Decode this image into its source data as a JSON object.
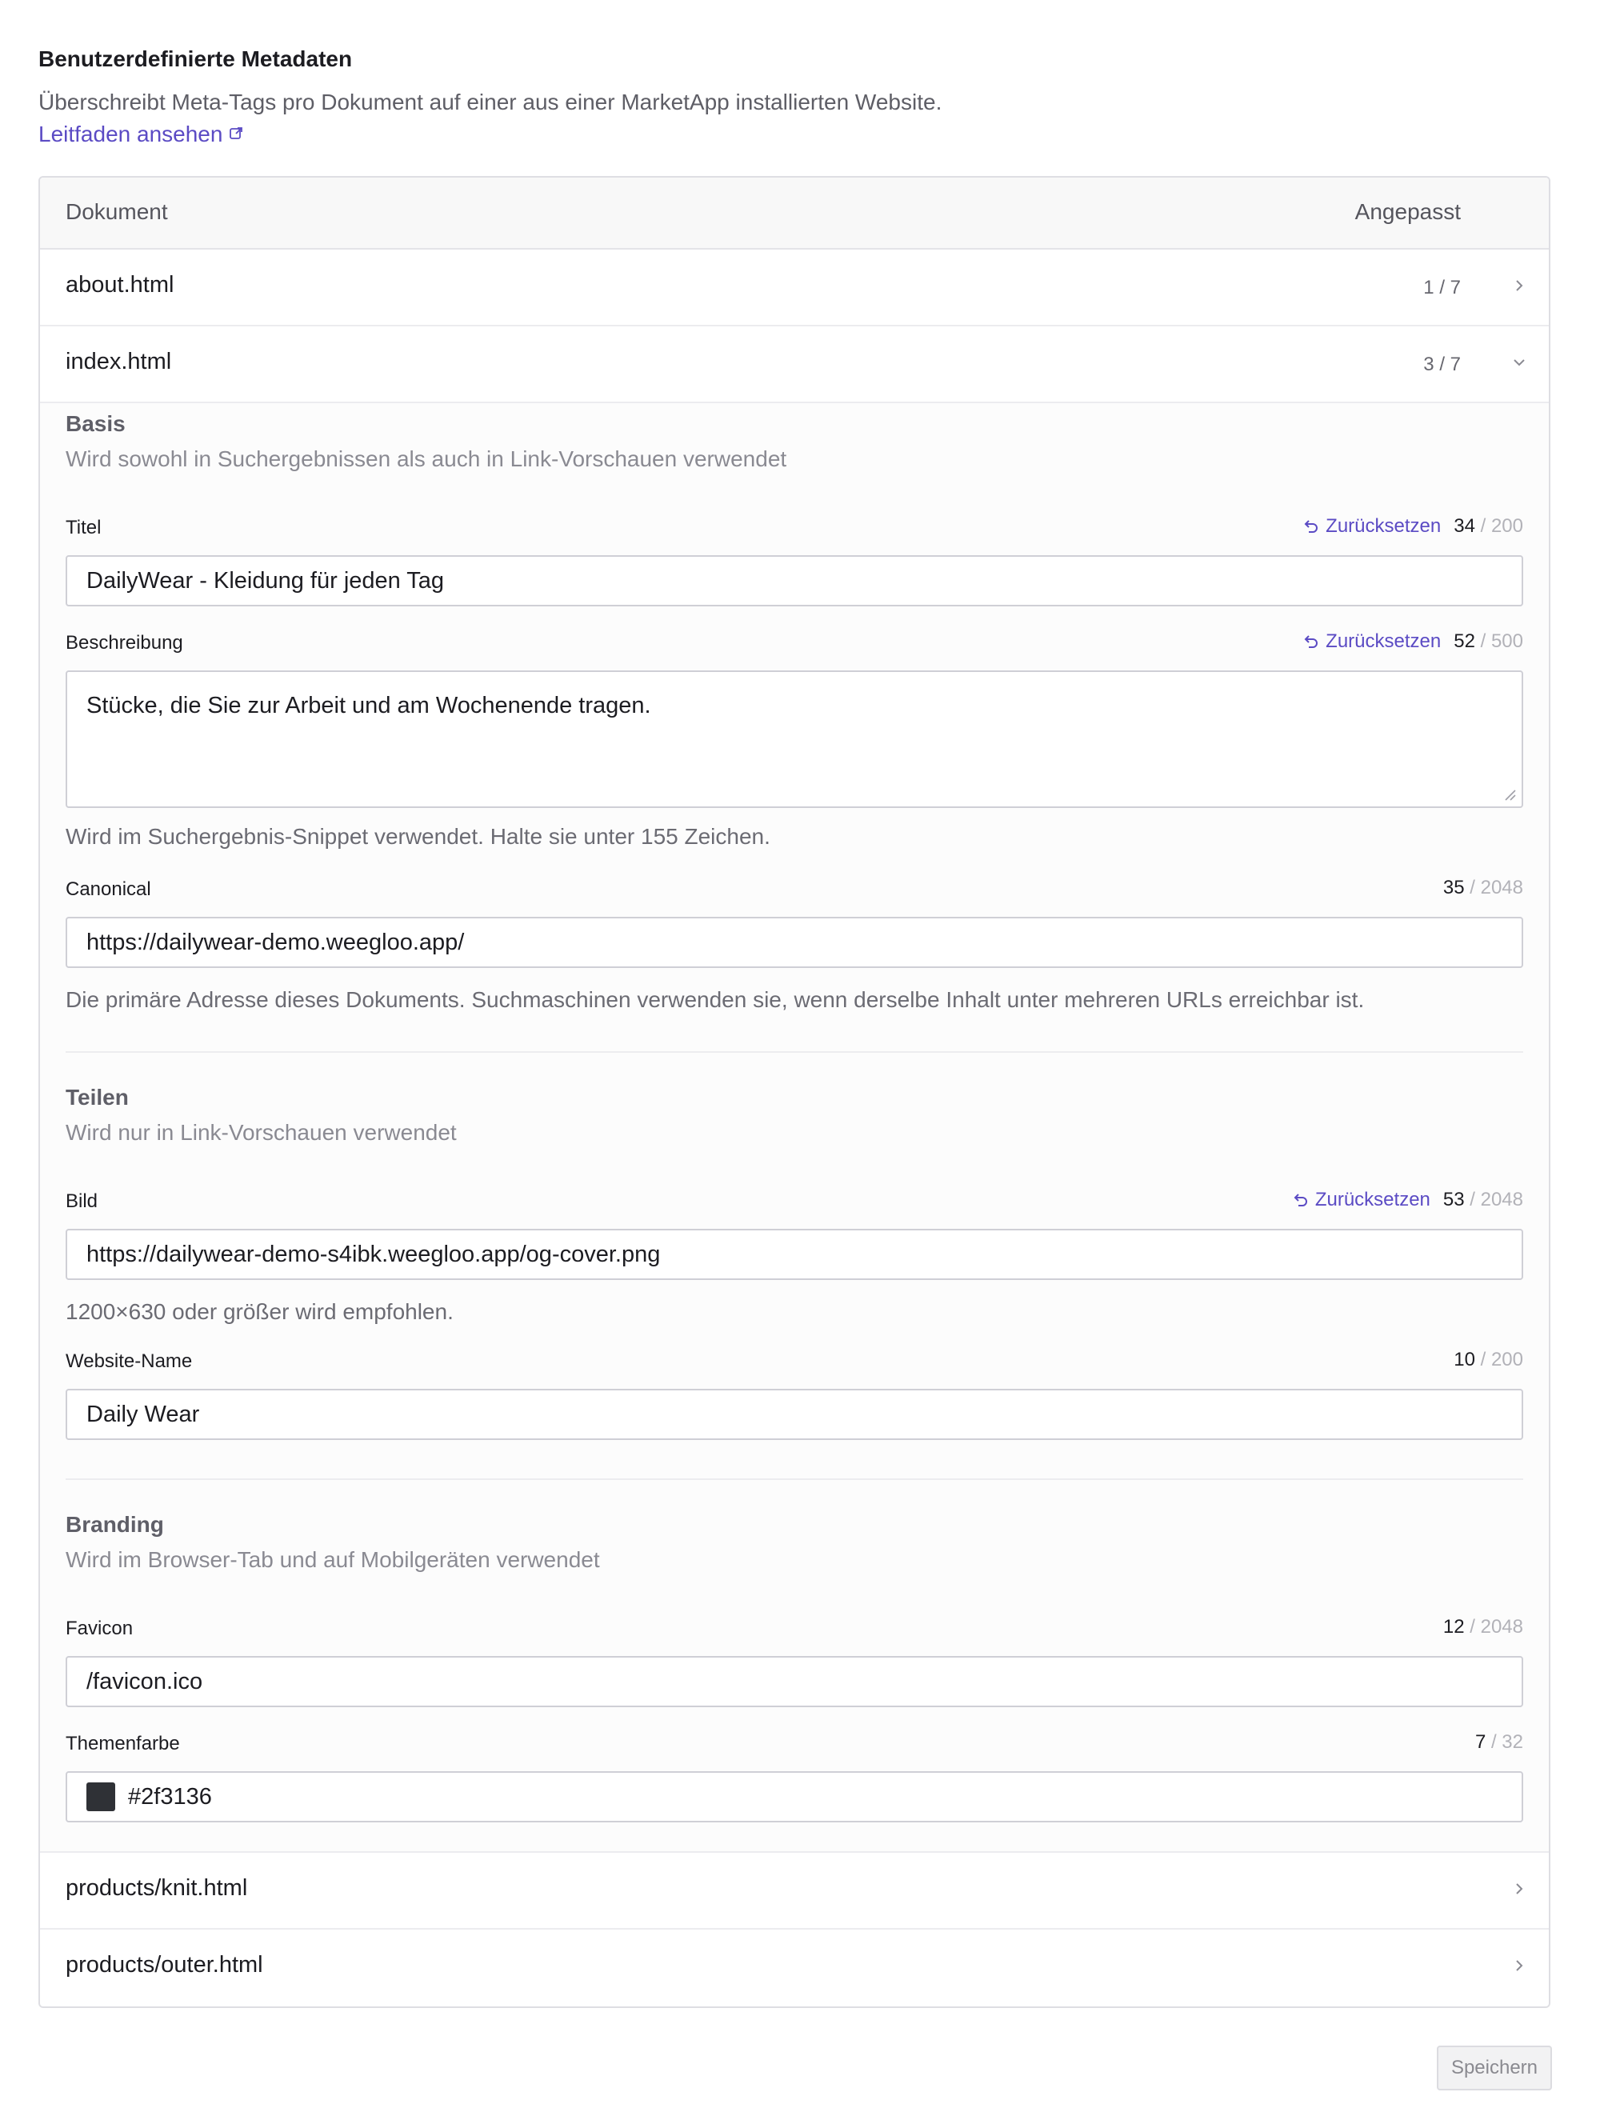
{
  "header": {
    "title": "Benutzerdefinierte Metadaten",
    "description": "Überschreibt Meta-Tags pro Dokument auf einer aus einer MarketApp installierten Website.",
    "guide_link": "Leitfaden ansehen"
  },
  "table": {
    "col_document": "Dokument",
    "col_custom": "Angepasst"
  },
  "documents": [
    {
      "name": "about.html",
      "count": "1 / 7",
      "state": "collapsed"
    },
    {
      "name": "index.html",
      "count": "3 / 7",
      "state": "expanded"
    },
    {
      "name": "products/knit.html",
      "count": "",
      "state": "collapsed"
    },
    {
      "name": "products/outer.html",
      "count": "",
      "state": "collapsed"
    }
  ],
  "editor": {
    "reset_label": "Zurücksetzen",
    "basis": {
      "title": "Basis",
      "desc": "Wird sowohl in Suchergebnissen als auch in Link-Vorschauen verwendet",
      "titel": {
        "label": "Titel",
        "value": "DailyWear - Kleidung für jeden Tag",
        "count": "34",
        "max": "/ 200"
      },
      "beschreibung": {
        "label": "Beschreibung",
        "value": "Stücke, die Sie zur Arbeit und am Wochenende tragen.",
        "count": "52",
        "max": "/ 500",
        "help": "Wird im Suchergebnis-Snippet verwendet. Halte sie unter 155 Zeichen."
      },
      "canonical": {
        "label": "Canonical",
        "value": "https://dailywear-demo.weegloo.app/",
        "count": "35",
        "max": "/ 2048",
        "help": "Die primäre Adresse dieses Dokuments. Suchmaschinen verwenden sie, wenn derselbe Inhalt unter mehreren URLs erreichbar ist."
      }
    },
    "teilen": {
      "title": "Teilen",
      "desc": "Wird nur in Link-Vorschauen verwendet",
      "bild": {
        "label": "Bild",
        "value": "https://dailywear-demo-s4ibk.weegloo.app/og-cover.png",
        "count": "53",
        "max": "/ 2048",
        "help": "1200×630 oder größer wird empfohlen."
      },
      "website_name": {
        "label": "Website-Name",
        "value": "Daily Wear",
        "count": "10",
        "max": "/ 200"
      }
    },
    "branding": {
      "title": "Branding",
      "desc": "Wird im Browser-Tab und auf Mobilgeräten verwendet",
      "favicon": {
        "label": "Favicon",
        "value": "/favicon.ico",
        "count": "12",
        "max": "/ 2048"
      },
      "themenfarbe": {
        "label": "Themenfarbe",
        "value": "#2f3136",
        "count": "7",
        "max": "/ 32",
        "swatch_color": "#2f3136"
      }
    }
  },
  "actions": {
    "save": "Speichern"
  },
  "colors": {
    "accent": "#5b4bc4",
    "border": "#dedee3"
  }
}
